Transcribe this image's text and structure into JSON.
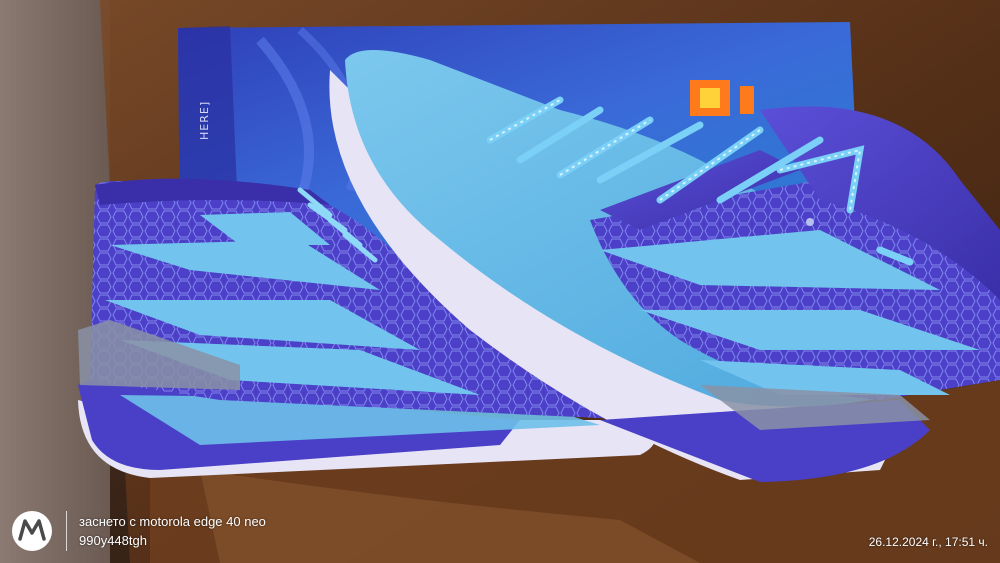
{
  "photo": {
    "subject": "basketball-sneakers-on-box",
    "box_side_text": "HERE]",
    "watermark": {
      "brand_icon": "motorola-logo-icon",
      "line1": "заснето с motorola edge 40 neo",
      "line2": "990y448tgh"
    },
    "timestamp": "26.12.2024 г., 17:51 ч."
  },
  "colors": {
    "shoe_light_blue": "#5fb8e6",
    "shoe_purple": "#4a3fc7",
    "sole_white": "#e6e4f5",
    "box_blue": "#3a5bd6",
    "chair_brown": "#6a3a1c"
  }
}
